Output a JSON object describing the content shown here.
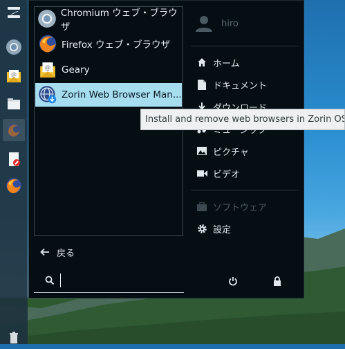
{
  "dock": {
    "items": [
      {
        "name": "zorin-menu"
      },
      {
        "name": "chromium"
      },
      {
        "name": "geary"
      },
      {
        "name": "files"
      },
      {
        "name": "firefox-running"
      },
      {
        "name": "software"
      },
      {
        "name": "firefox"
      }
    ]
  },
  "apps": [
    {
      "label": "Chromium ウェブ・ブラウザ",
      "icon": "chromium-icon"
    },
    {
      "label": "Firefox ウェブ・ブラウザ",
      "icon": "firefox-icon"
    },
    {
      "label": "Geary",
      "icon": "geary-mail-icon"
    },
    {
      "label": "Zorin Web Browser Man...",
      "icon": "web-browser-manager-icon",
      "selected": true
    }
  ],
  "back_label": "戻る",
  "search": {
    "value": ""
  },
  "user": {
    "name": "hiro"
  },
  "places": [
    {
      "label": "ホーム",
      "icon": "home-icon"
    },
    {
      "label": "ドキュメント",
      "icon": "document-icon"
    },
    {
      "label": "ダウンロード",
      "icon": "download-icon"
    },
    {
      "label": "ミュージック",
      "icon": "music-icon"
    },
    {
      "label": "ピクチャ",
      "icon": "picture-icon"
    },
    {
      "label": "ビデオ",
      "icon": "video-icon"
    }
  ],
  "system": [
    {
      "label": "ソフトウェア",
      "icon": "software-icon",
      "disabled": true
    },
    {
      "label": "設定",
      "icon": "settings-gear-icon"
    }
  ],
  "tooltip": "Install and remove web browsers in Zorin OS"
}
